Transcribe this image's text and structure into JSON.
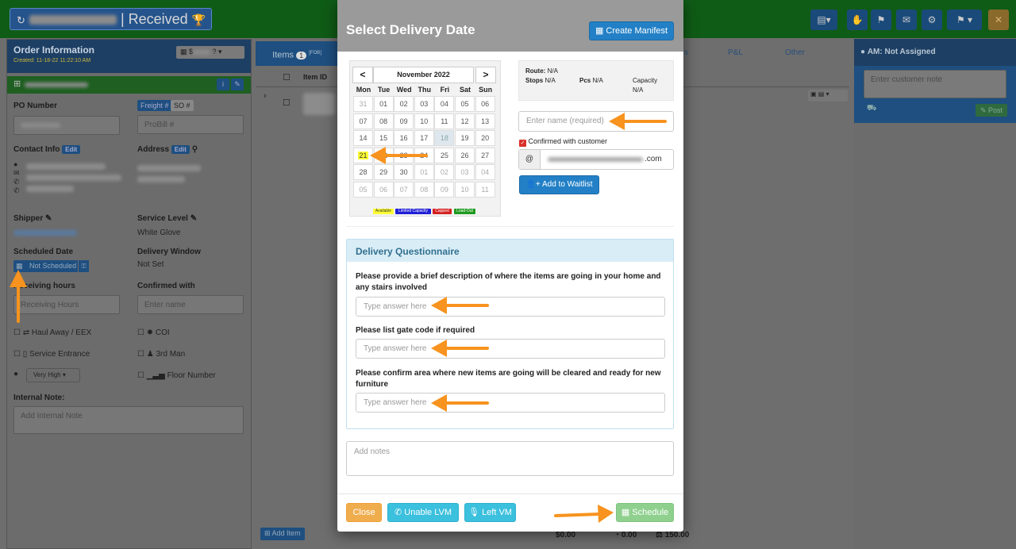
{
  "background": {
    "title": "| Received",
    "order_panel": {
      "title": "Order Information",
      "created": "Created: 11-18-22 11:22:10 AM",
      "badge_value": "$",
      "po_label": "PO Number",
      "freight_tab": "Freight #",
      "so_tab": "SO #",
      "probill_placeholder": "ProBill #",
      "contact_label": "Contact Info",
      "address_label": "Address",
      "edit_label": "Edit",
      "shipper_label": "Shipper",
      "service_level_label": "Service Level",
      "service_level_value": "White Glove",
      "scheduled_date_label": "Scheduled Date",
      "not_scheduled": "Not Scheduled",
      "delivery_window_label": "Delivery Window",
      "delivery_window_value": "Not Set",
      "receiving_hours_label": "Receiving hours",
      "receiving_hours_placeholder": "Receiving Hours",
      "confirmed_with_label": "Confirmed with",
      "enter_name_placeholder": "Enter name",
      "haul_away": "Haul Away / EEX",
      "coi": "COI",
      "service_entrance": "Service Entrance",
      "third_man": "3rd Man",
      "priority": "Very High",
      "floor_number": "Floor Number",
      "internal_note_label": "Internal Note:",
      "internal_note_placeholder": "Add Internal Note"
    },
    "items_panel": {
      "tab_items": "Items",
      "items_count": "1",
      "tab_items_extra": "[FOB]",
      "tab_s": "s",
      "tab_pl": "P&L",
      "tab_other": "Other",
      "col_item_id": "Item ID",
      "add_item": "Add Item",
      "total_1": "$0.00",
      "total_2": "0.00",
      "total_3": "150.00"
    },
    "right_panel": {
      "am_label": "AM: Not Assigned",
      "note_placeholder": "Enter customer note",
      "post_label": "Post"
    }
  },
  "modal": {
    "title": "Select Delivery Date",
    "create_manifest": "Create Manifest",
    "calendar": {
      "month": "November 2022",
      "prev": "<",
      "next": ">",
      "weekdays": [
        "Mon",
        "Tue",
        "Wed",
        "Thu",
        "Fri",
        "Sat",
        "Sun"
      ],
      "weeks": [
        [
          "31",
          "01",
          "02",
          "03",
          "04",
          "05",
          "06"
        ],
        [
          "07",
          "08",
          "09",
          "10",
          "11",
          "12",
          "13"
        ],
        [
          "14",
          "15",
          "16",
          "17",
          "18",
          "19",
          "20"
        ],
        [
          "21",
          "22",
          "23",
          "24",
          "25",
          "26",
          "27"
        ],
        [
          "28",
          "29",
          "30",
          "01",
          "02",
          "03",
          "04"
        ],
        [
          "05",
          "06",
          "07",
          "08",
          "09",
          "10",
          "11"
        ]
      ],
      "selected": "21",
      "today": "18",
      "legend": [
        {
          "label": "Available",
          "color": "#ffff33",
          "text": "#333333"
        },
        {
          "label": "Limited Capacity",
          "color": "#1f1fd6",
          "text": "#ffffff"
        },
        {
          "label": "Capped",
          "color": "#d42020",
          "text": "#ffffff"
        },
        {
          "label": "Load-Out",
          "color": "#1f9a1f",
          "text": "#ffffff"
        }
      ]
    },
    "route": {
      "route_label": "Route:",
      "route_value": "N/A",
      "stops_label": "Stops",
      "stops_value": "N/A",
      "pcs_label": "Pcs",
      "pcs_value": "N/A",
      "capacity_label": "Capacity",
      "capacity_value": "N/A"
    },
    "name_placeholder": "Enter name (required)",
    "confirmed_label": "Confirmed with customer",
    "email_prefix": "@",
    "email_suffix": ".com",
    "add_waitlist": "Add to Waitlist",
    "questionnaire": {
      "title": "Delivery Questionnaire",
      "questions": [
        {
          "text": "Please provide a brief description of where the items are going in your home and any stairs involved",
          "placeholder": "Type answer here"
        },
        {
          "text": "Please list gate code if required",
          "placeholder": "Type answer here"
        },
        {
          "text": "Please confirm area where new items are going will be cleared and ready for new furniture",
          "placeholder": "Type answer here"
        }
      ]
    },
    "notes_placeholder": "Add notes",
    "buttons": {
      "close": "Close",
      "unable_lvm": "Unable LVM",
      "left_vm": "Left VM",
      "schedule": "Schedule"
    },
    "colors": {
      "primary": "#2380c6",
      "close": "#f0ad4e",
      "info": "#3bc0de",
      "schedule": "#8fd08f",
      "arrow": "#f7931e"
    }
  }
}
